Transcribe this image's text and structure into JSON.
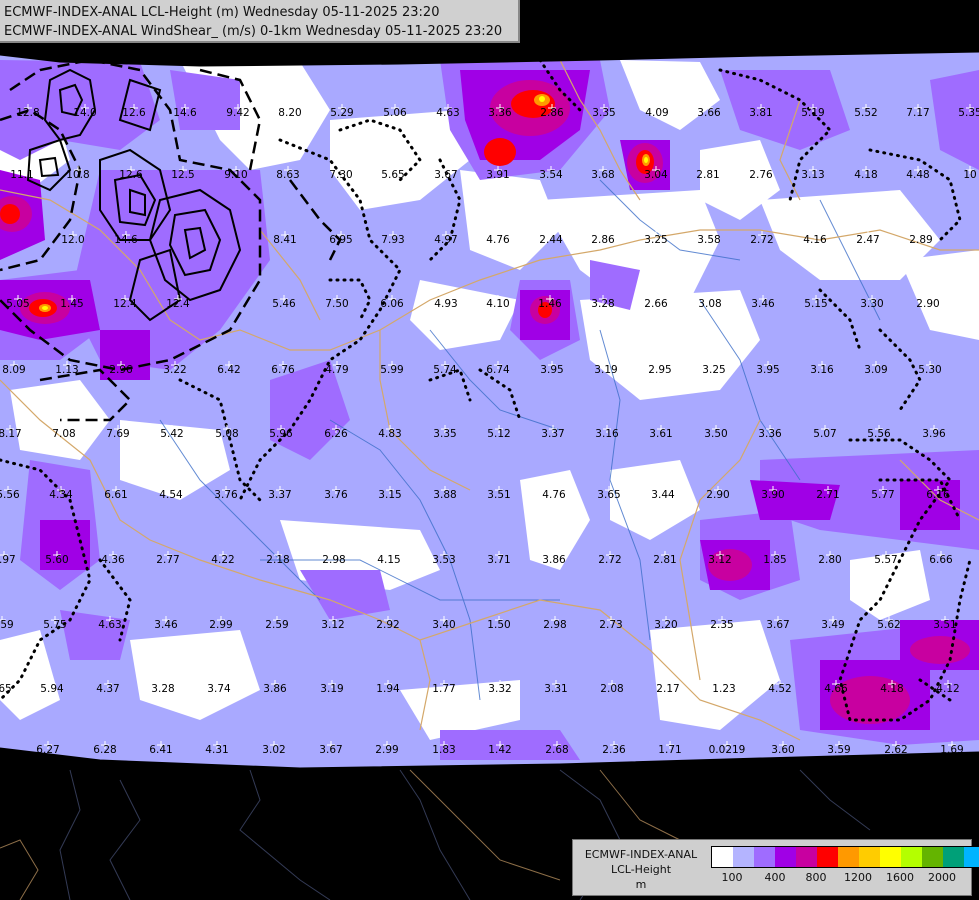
{
  "header": {
    "line1": "ECMWF-INDEX-ANAL LCL-Height (m) Wednesday 05-11-2025 23:20",
    "line2": "ECMWF-INDEX-ANAL WindShear_ (m/s) 0-1km Wednesday 05-11-2025 23:20"
  },
  "legend": {
    "line1": "ECMWF-INDEX-ANAL",
    "line2": "LCL-Height",
    "line3": "m",
    "colors": [
      "#ffffff",
      "#b4b4ff",
      "#9f6cff",
      "#a000e6",
      "#c800a0",
      "#ff0000",
      "#ff9900",
      "#ffcc00",
      "#ffff00",
      "#b4ff00",
      "#64b400",
      "#00a078",
      "#00b4ff"
    ],
    "ticks": [
      "100",
      "400",
      "800",
      "1200",
      "1600",
      "2000"
    ]
  },
  "colors": {
    "background": "#000000",
    "land": "#a9a9ff"
  },
  "values": [
    "12.8",
    "14.0",
    "12.6",
    "14.6",
    "9.42",
    "8.20",
    "5.29",
    "5.06",
    "4.63",
    "3.36",
    "2.86",
    "3.35",
    "4.09",
    "3.66",
    "3.81",
    "5.19",
    "5.52",
    "7.17",
    "5.35",
    "11.1",
    "10.8",
    "12.6",
    "12.5",
    "9.10",
    "8.63",
    "7.30",
    "5.65",
    "3.67",
    "3.91",
    "3.54",
    "3.68",
    "3.04",
    "2.81",
    "2.76",
    "3.13",
    "4.18",
    "4.48",
    "10",
    "12.0",
    "14.6",
    "8.41",
    "6.95",
    "7.93",
    "4.97",
    "4.76",
    "2.44",
    "2.86",
    "3.25",
    "3.58",
    "2.72",
    "4.16",
    "2.47",
    "2.89",
    "5.05",
    "1.45",
    "12.4",
    "12.4",
    "5.46",
    "7.50",
    "6.06",
    "4.93",
    "4.10",
    "1.46",
    "3.28",
    "2.66",
    "3.08",
    "3.46",
    "5.15",
    "3.30",
    "2.90",
    "8.09",
    "1.13",
    "2.96",
    "3.22",
    "6.42",
    "6.76",
    "4.79",
    "5.99",
    "5.74",
    "6.74",
    "3.95",
    "3.19",
    "2.95",
    "3.25",
    "3.95",
    "3.16",
    "3.09",
    "5.30",
    "8.17",
    "7.08",
    "7.69",
    "5.42",
    "5.08",
    "5.96",
    "6.26",
    "4.83",
    "3.35",
    "5.12",
    "3.37",
    "3.16",
    "3.61",
    "3.50",
    "3.36",
    "5.07",
    "5.56",
    "3.96",
    "5.56",
    "4.34",
    "6.61",
    "4.54",
    "3.76",
    "3.37",
    "3.76",
    "3.15",
    "3.88",
    "3.51",
    "4.76",
    "3.65",
    "3.44",
    "2.90",
    "3.90",
    "2.71",
    "5.77",
    "6.16",
    "6.97",
    "5.60",
    "4.36",
    "2.77",
    "4.22",
    "2.18",
    "2.98",
    "4.15",
    "3.53",
    "3.71",
    "3.86",
    "2.72",
    "2.81",
    "3.12",
    "1.85",
    "2.80",
    "5.57",
    "6.66",
    "6.59",
    "5.75",
    "4.63",
    "3.46",
    "2.99",
    "2.59",
    "3.12",
    "2.92",
    "3.40",
    "1.50",
    "2.98",
    "2.73",
    "3.20",
    "2.35",
    "3.67",
    "3.49",
    "5.62",
    "3.51",
    "5.65",
    "5.94",
    "4.37",
    "3.28",
    "3.74",
    "3.86",
    "3.19",
    "1.94",
    "1.77",
    "3.32",
    "3.31",
    "2.08",
    "2.17",
    "1.23",
    "4.52",
    "4.66",
    "4.18",
    "4.12",
    "6.27",
    "6.28",
    "6.41",
    "4.31",
    "3.02",
    "3.67",
    "2.99",
    "1.83",
    "1.42",
    "2.68",
    "2.36",
    "1.71",
    "0.0219",
    "3.60",
    "3.59",
    "2.62",
    "1.69"
  ]
}
